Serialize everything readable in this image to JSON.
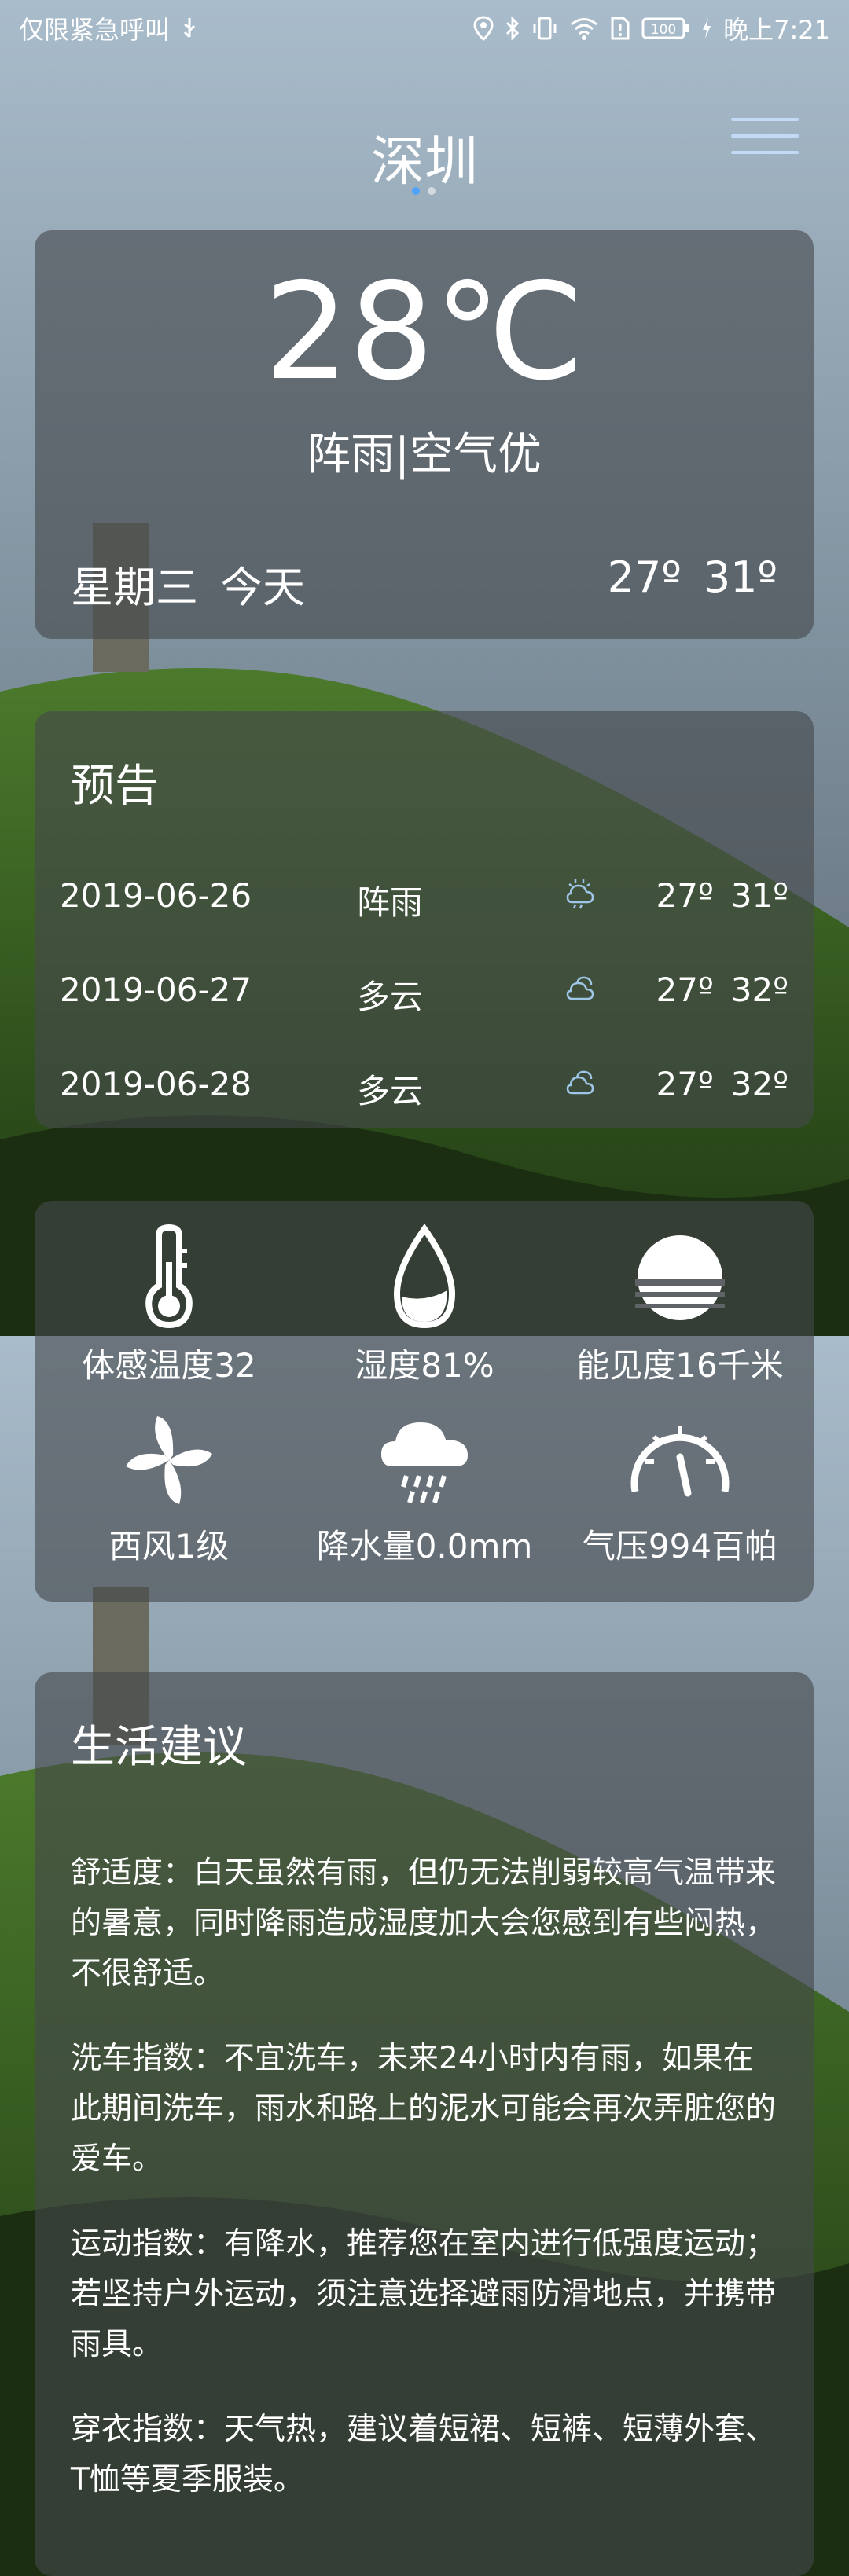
{
  "status_bar": {
    "left_text": "仅限紧急呼叫",
    "battery": "100",
    "time": "晚上7:21"
  },
  "header": {
    "city": "深圳",
    "page_dots": 2,
    "active_dot": 0
  },
  "now": {
    "temperature": "28℃",
    "condition": "阵雨|空气优",
    "weekday": "星期三",
    "day_label": "今天",
    "low": "27º",
    "high": "31º"
  },
  "forecast": {
    "title": "预告",
    "rows": [
      {
        "date": "2019-06-26",
        "condition": "阵雨",
        "icon": "shower-icon",
        "low": "27º",
        "high": "31º"
      },
      {
        "date": "2019-06-27",
        "condition": "多云",
        "icon": "cloudy-icon",
        "low": "27º",
        "high": "32º"
      },
      {
        "date": "2019-06-28",
        "condition": "多云",
        "icon": "cloudy-icon",
        "low": "27º",
        "high": "32º"
      }
    ]
  },
  "details": [
    {
      "label": "体感温度32",
      "icon": "thermometer-icon"
    },
    {
      "label": "湿度81%",
      "icon": "humidity-drop-icon"
    },
    {
      "label": "能见度16千米",
      "icon": "visibility-icon"
    },
    {
      "label": "西风1级",
      "icon": "wind-fan-icon"
    },
    {
      "label": "降水量0.0mm",
      "icon": "rain-cloud-icon"
    },
    {
      "label": "气压994百帕",
      "icon": "pressure-gauge-icon"
    }
  ],
  "life": {
    "title": "生活建议",
    "items": [
      {
        "text": "舒适度：白天虽然有雨，但仍无法削弱较高气温带来的暑意，同时降雨造成湿度加大会您感到有些闷热，不很舒适。"
      },
      {
        "text": "洗车指数：不宜洗车，未来24小时内有雨，如果在此期间洗车，雨水和路上的泥水可能会再次弄脏您的爱车。"
      },
      {
        "text": "运动指数：有降水，推荐您在室内进行低强度运动；若坚持户外运动，须注意选择避雨防滑地点，并携带雨具。"
      },
      {
        "text": "穿衣指数：天气热，建议着短裙、短裤、短薄外套、T恤等夏季服装。"
      }
    ]
  },
  "colors": {
    "card_bg": "#46484c",
    "accent_dot": "#4fa3f7",
    "menu": "#c8e1ff"
  }
}
